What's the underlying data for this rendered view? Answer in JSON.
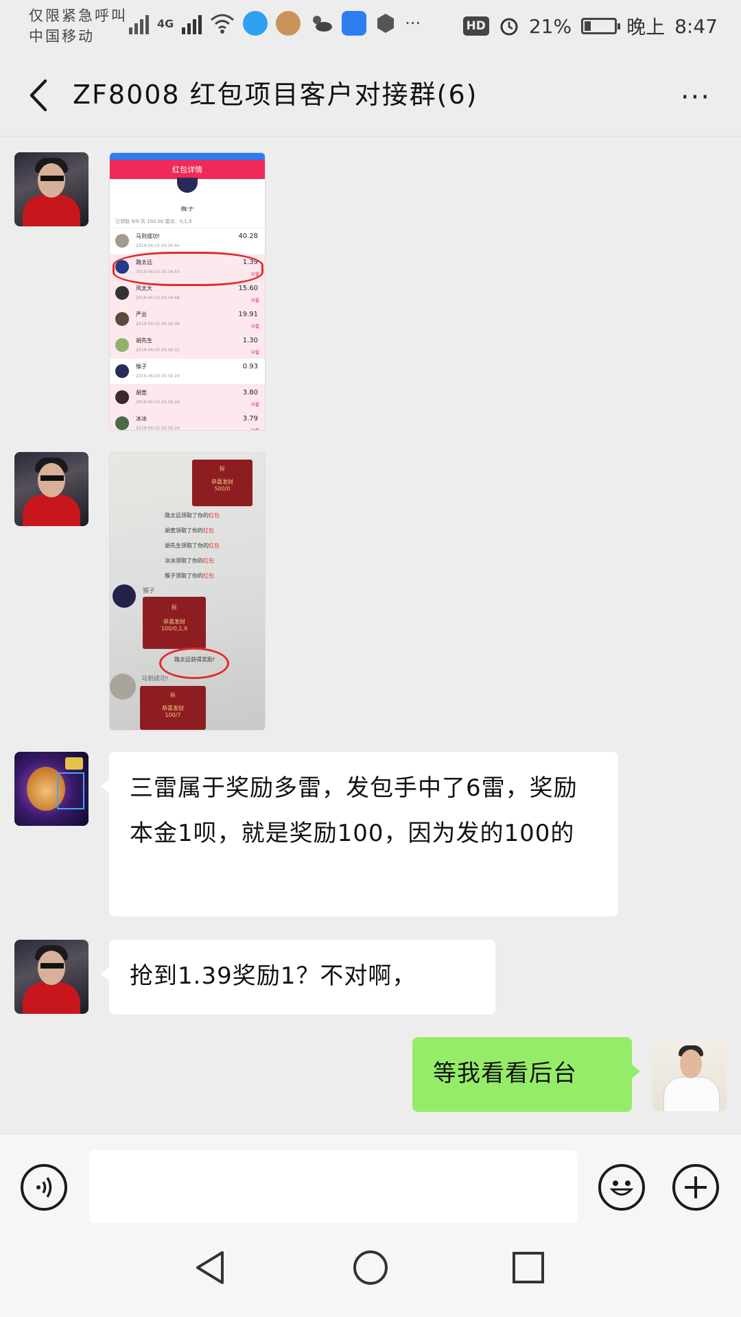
{
  "status_bar": {
    "carrier_line1": "仅限紧急呼叫",
    "carrier_line2": "中国移动",
    "network": "4G",
    "hd_label": "HD",
    "battery_percent": "21%",
    "time_prefix": "晚上",
    "time": "8:47",
    "battery_level": 0.21
  },
  "header": {
    "title": "ZF8008 红包项目客户对接群(6)",
    "more_label": "···"
  },
  "screenshot1": {
    "header_title": "红包详情",
    "sender_name": "猴子",
    "summary": "已领取 9/9 共 100.00    雷点：0,1,9",
    "rows": [
      {
        "name": "马到成功!",
        "time": "2019-06-03  20:34:50",
        "amount": "40.28",
        "tag": ""
      },
      {
        "name": "路太远",
        "time": "2019-06-03  20:34:50",
        "amount": "1.39",
        "tag": "中雷"
      },
      {
        "name": "风太大",
        "time": "2019-06-03  20:34:48",
        "amount": "15.60",
        "tag": "中雷"
      },
      {
        "name": "严总",
        "time": "2019-06-03  20:34:39",
        "amount": "19.91",
        "tag": "中雷"
      },
      {
        "name": "胡先生",
        "time": "2019-06-03  20:34:32",
        "amount": "1.30",
        "tag": "中雷"
      },
      {
        "name": "猴子",
        "time": "2019-06-03  20:34:24",
        "amount": "0.93",
        "tag": ""
      },
      {
        "name": "胡宽",
        "time": "2019-06-03  20:34:24",
        "amount": "3.80",
        "tag": "中雷"
      },
      {
        "name": "冰冰",
        "time": "2019-06-03  20:34:24",
        "amount": "3.79",
        "tag": "中雷"
      }
    ]
  },
  "screenshot2": {
    "rp_top_title": "拆",
    "rp_top_text": "恭喜发财",
    "rp_top_sub": "500/0",
    "notices": [
      {
        "pre": "路太远领取了你的",
        "post": "红包"
      },
      {
        "pre": "胡宽领取了你的",
        "post": "红包"
      },
      {
        "pre": "胡先生领取了你的",
        "post": "红包"
      },
      {
        "pre": "冰冰领取了你的",
        "post": "红包"
      },
      {
        "pre": "猴子领取了你的",
        "post": "红包"
      }
    ],
    "sender1": "猴子",
    "rp_mid_title": "拆",
    "rp_mid_text": "恭喜发财",
    "rp_mid_sub": "100/0,1,9",
    "reward_notice": "路太远获得奖励!",
    "sender2": "马到成功!",
    "rp_bot_title": "拆",
    "rp_bot_text": "恭喜发财",
    "rp_bot_sub": "100/7"
  },
  "messages": {
    "msg3": "三雷属于奖励多雷，发包手中了6雷，奖励本金1呗，就是奖励100，因为发的100的",
    "msg4": "抢到1.39奖励1？不对啊，",
    "msg5": "等我看看后台"
  },
  "input": {
    "placeholder": ""
  }
}
